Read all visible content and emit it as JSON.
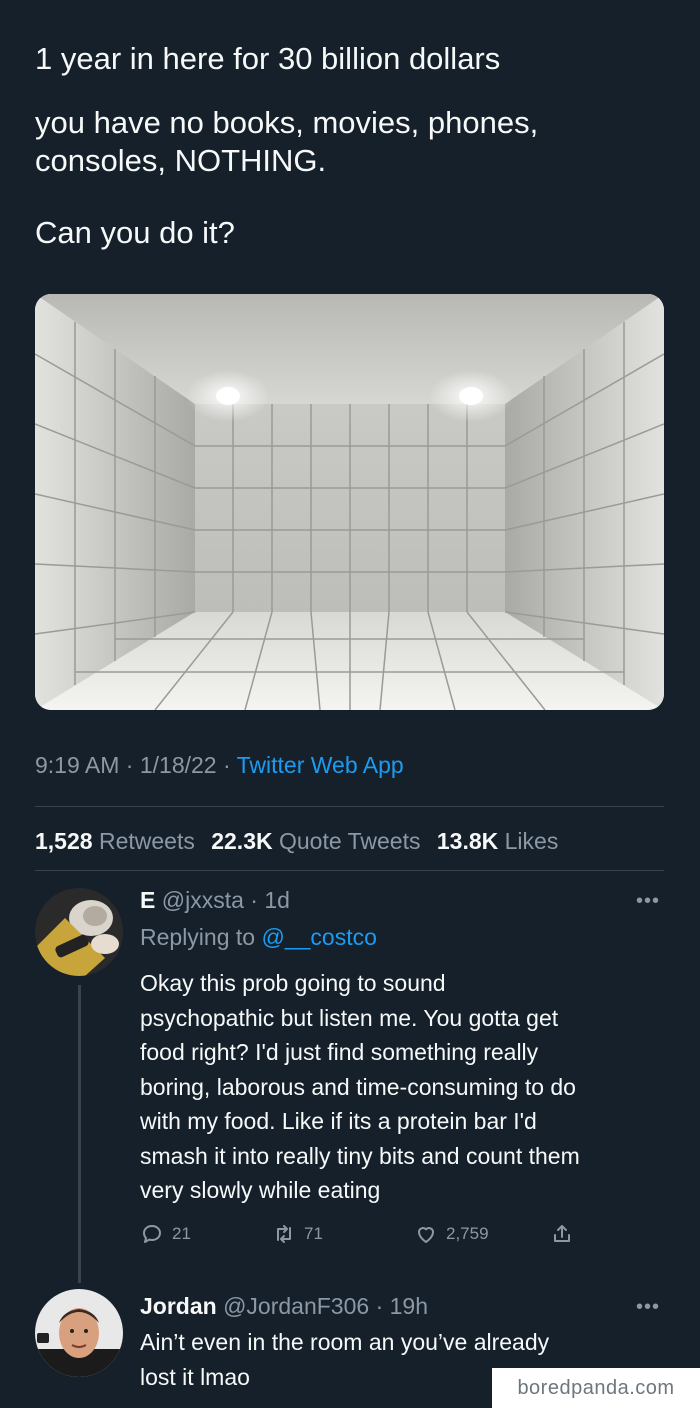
{
  "tweet": {
    "line1": "1 year in here for 30 billion dollars",
    "line2a": "you have no books, movies, phones,",
    "line2b": "consoles, NOTHING.",
    "line3": "Can you do it?",
    "time": "9:19 AM",
    "date": "1/18/22",
    "sep": "·",
    "app": "Twitter Web App",
    "retweets_count": "1,528",
    "retweets_label": "Retweets",
    "quotes_count": "22.3K",
    "quotes_label": "Quote Tweets",
    "likes_count": "13.8K",
    "likes_label": "Likes"
  },
  "reply1": {
    "name": "E",
    "handle": "@jxxsta",
    "age": "· 1d",
    "replying_prefix": "Replying to",
    "replying_handle": "@__costco",
    "lines": [
      "Okay this prob going to sound",
      "psychopathic but listen me. You gotta get",
      "food right? I'd just find something really",
      "boring, laborous and time-consuming to do",
      "with my food. Like if its a protein bar I'd",
      "smash it into really tiny bits and count them",
      "very slowly while eating"
    ],
    "replies": "21",
    "retweets": "71",
    "likes": "2,759"
  },
  "reply2": {
    "name": "Jordan",
    "handle": "@JordanF306",
    "age": "· 19h",
    "lines": [
      "Ain’t even in the room an you’ve already",
      "lost it lmao"
    ]
  },
  "more_glyph": "•••",
  "watermark": "boredpanda.com",
  "icons": [
    "reply-icon",
    "retweet-icon",
    "heart-icon",
    "share-icon",
    "more-icon"
  ],
  "colors": {
    "background": "#15202b",
    "accent": "#1d9bf0",
    "muted": "#8b98a5",
    "text": "#f7f9f9"
  }
}
